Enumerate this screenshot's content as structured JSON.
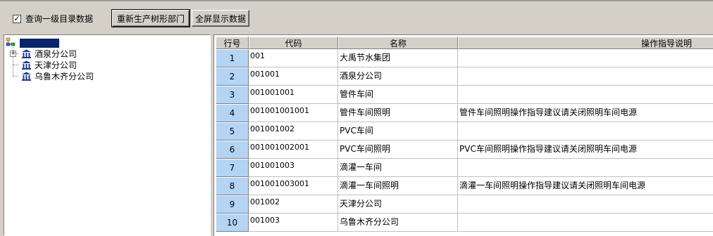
{
  "toolbar": {
    "checkbox_label": "查询一级目录数据",
    "checkbox_checked": true,
    "regen_button": "重新生产树形部门",
    "fullscreen_button": "全屏显示数据"
  },
  "tree": {
    "children": [
      {
        "label": "酒泉分公司"
      },
      {
        "label": "天津分公司"
      },
      {
        "label": "乌鲁木齐分公司"
      }
    ]
  },
  "grid": {
    "columns": [
      "行号",
      "代码",
      "名称",
      "操作指导说明"
    ],
    "rows": [
      {
        "num": "1",
        "code": "001",
        "name": "大禹节水集团",
        "desc": ""
      },
      {
        "num": "2",
        "code": "001001",
        "name": "酒泉分公司",
        "desc": ""
      },
      {
        "num": "3",
        "code": "001001001",
        "name": "管件车间",
        "desc": ""
      },
      {
        "num": "4",
        "code": "001001001001",
        "name": "管件车间照明",
        "desc": "管件车间照明操作指导建议请关闭照明车间电源"
      },
      {
        "num": "5",
        "code": "001001002",
        "name": "PVC车间",
        "desc": ""
      },
      {
        "num": "6",
        "code": "001001002001",
        "name": "PVC车间照明",
        "desc": "PVC车间照明操作指导建议请关闭照明车间电源"
      },
      {
        "num": "7",
        "code": "001001003",
        "name": "滴灌一车间",
        "desc": ""
      },
      {
        "num": "8",
        "code": "001001003001",
        "name": "滴灌一车间照明",
        "desc": "滴灌一车间照明操作指导建议请关闭照明车间电源"
      },
      {
        "num": "9",
        "code": "001002",
        "name": "天津分公司",
        "desc": ""
      },
      {
        "num": "10",
        "code": "001003",
        "name": "乌鲁木齐分公司",
        "desc": ""
      }
    ]
  }
}
